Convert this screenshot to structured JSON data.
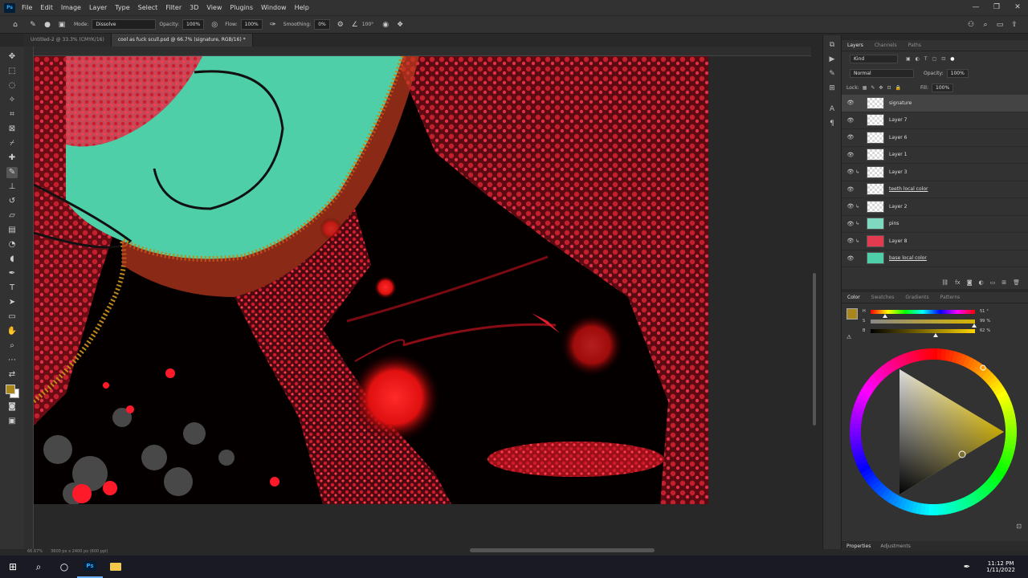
{
  "app": {
    "logo": "Ps"
  },
  "menu": [
    "File",
    "Edit",
    "Image",
    "Layer",
    "Type",
    "Select",
    "Filter",
    "3D",
    "View",
    "Plugins",
    "Window",
    "Help"
  ],
  "options": {
    "mode_label": "Mode:",
    "mode_value": "Dissolve",
    "opacity_label": "Opacity:",
    "opacity_value": "100%",
    "flow_label": "Flow:",
    "flow_value": "100%",
    "smoothing_label": "Smoothing:",
    "smoothing_value": "0%",
    "angle_value": "100°"
  },
  "tabs": [
    {
      "label": "Untitled-2 @ 33.3% (CMYK/16)"
    },
    {
      "label": "cool as fuck scull.psd @ 66.7% (signature, RGB/16) *"
    }
  ],
  "status": {
    "zoom": "66.67%",
    "doc": "3600 px x 2400 px (600 ppi)"
  },
  "layers_panel": {
    "tabs": [
      "Layers",
      "Channels",
      "Paths"
    ],
    "kind_label": "Kind",
    "blend_mode": "Normal",
    "opacity_label": "Opacity:",
    "opacity_value": "100%",
    "lock_label": "Lock:",
    "fill_label": "Fill:",
    "fill_value": "100%",
    "layers": [
      {
        "name": "signature"
      },
      {
        "name": "Layer 7"
      },
      {
        "name": "Layer 6"
      },
      {
        "name": "Layer 1"
      },
      {
        "name": "Layer 3"
      },
      {
        "name": "teeth local color"
      },
      {
        "name": "Layer 2"
      },
      {
        "name": "pins"
      },
      {
        "name": "Layer 8"
      },
      {
        "name": "base local color"
      }
    ]
  },
  "color_panel": {
    "tabs": [
      "Color",
      "Swatches",
      "Gradients",
      "Patterns"
    ],
    "sliders": [
      {
        "label": "H",
        "value": "51",
        "unit": "°",
        "fraction": 0.14
      },
      {
        "label": "S",
        "value": "99",
        "unit": "%",
        "fraction": 0.99
      },
      {
        "label": "B",
        "value": "62",
        "unit": "%",
        "fraction": 0.62
      }
    ],
    "foreground_color": "#a8861b",
    "background_color": "#ffffff"
  },
  "bottom_tabs": [
    "Properties",
    "Adjustments"
  ],
  "clock": {
    "time": "11:12 PM",
    "date": "1/11/2022"
  }
}
